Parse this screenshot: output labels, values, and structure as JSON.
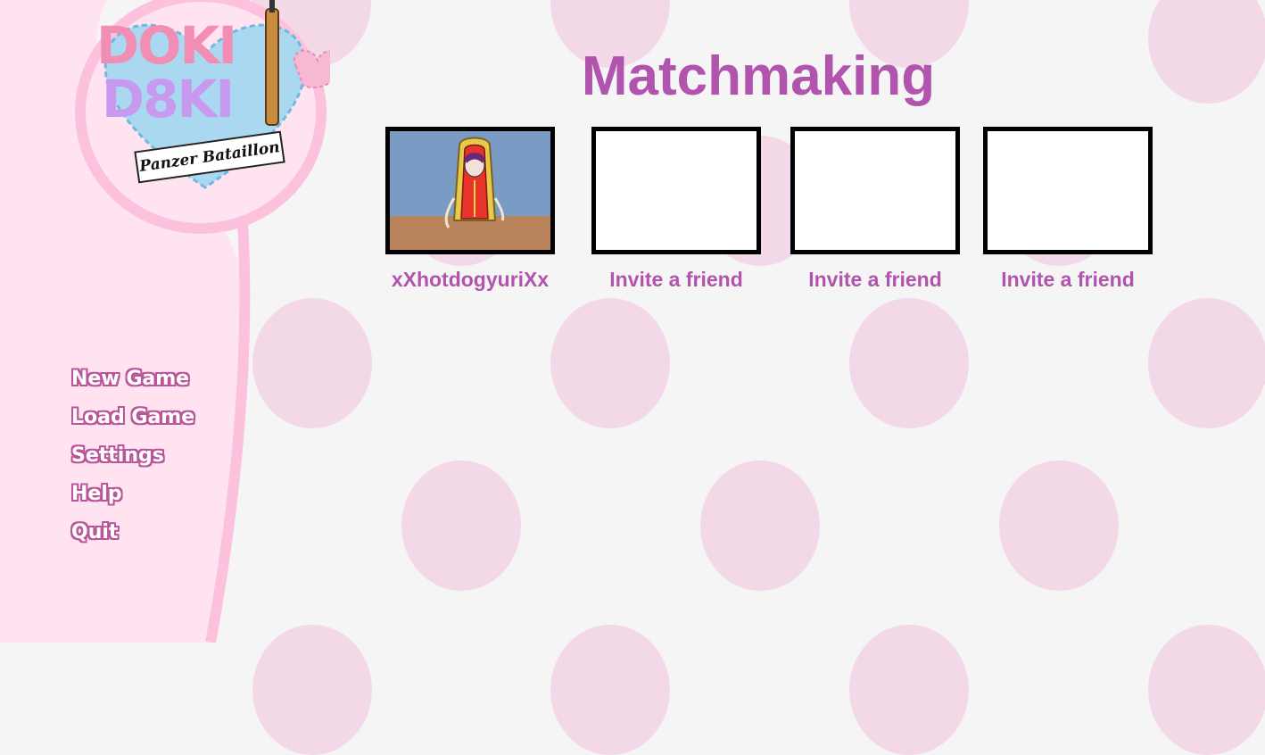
{
  "logo": {
    "word_top": "DOKI",
    "word_bottom": "D8KI",
    "subtitle": "Panzer Bataillon"
  },
  "menu": [
    "New Game",
    "Load Game",
    "Settings",
    "Help",
    "Quit"
  ],
  "title": "Matchmaking",
  "slots": [
    {
      "label": "xXhotdogyuriXx",
      "filled": true
    },
    {
      "label": "Invite a friend",
      "filled": false
    },
    {
      "label": "Invite a friend",
      "filled": false
    },
    {
      "label": "Invite a friend",
      "filled": false
    }
  ],
  "colors": {
    "accent": "#b054ad",
    "background": "#f6f5f6",
    "polka_dot": "#f3d8e8",
    "sidebar": "#ffe3f0",
    "sidebar_trim": "#fcc1dc"
  }
}
